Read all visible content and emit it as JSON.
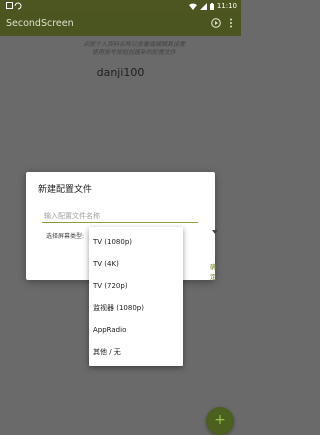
{
  "status_bar": {
    "notification_icons": [
      "photo-icon",
      "sync-icon"
    ],
    "system_icons": [
      "wifi-icon",
      "signal-icon",
      "battery-icon"
    ],
    "time": "11:10"
  },
  "app_bar": {
    "title": "SecondScreen",
    "action_icons": [
      "play-icon",
      "overflow-menu-icon"
    ]
  },
  "main": {
    "hint_line1": "点按个人资料名称以查看或编辑其设置",
    "hint_line2": "使用按号按钮创建新的配置文件",
    "profile_name": "danji100"
  },
  "dialog": {
    "title": "新建配置文件",
    "name_placeholder": "输入配置文件名称",
    "name_value": "",
    "type_label": "选择屏幕类型:",
    "ok_label": "确定"
  },
  "dropdown": {
    "options": [
      "TV (1080p)",
      "TV (4K)",
      "TV (720p)",
      "监视器 (1080p)",
      "AppRadio",
      "其他 / 无"
    ]
  },
  "fab": {
    "label": "+"
  },
  "colors": {
    "status_bar": "#4d5620",
    "app_bar": "#4b551f",
    "accent": "#8aa13a",
    "fab": "#4b5f1e",
    "scrim_background": "#6a6a6a"
  }
}
